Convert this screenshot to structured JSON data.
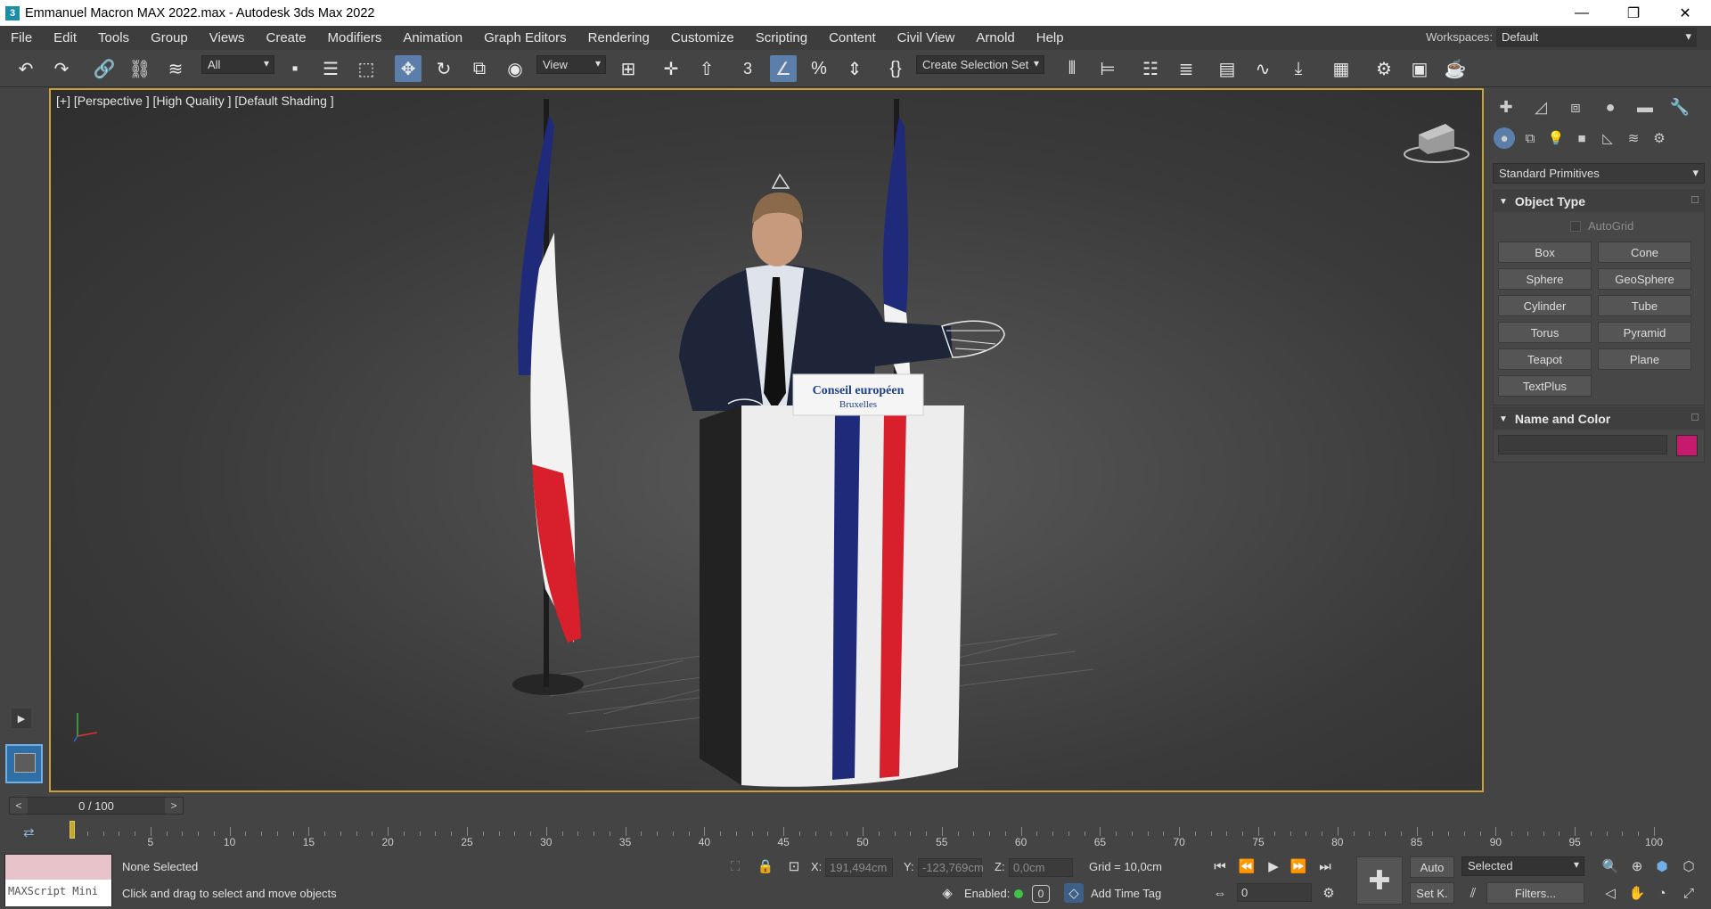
{
  "window": {
    "title": "Emmanuel Macron MAX 2022.max - Autodesk 3ds Max 2022",
    "app_icon": "3"
  },
  "menu": [
    "File",
    "Edit",
    "Tools",
    "Group",
    "Views",
    "Create",
    "Modifiers",
    "Animation",
    "Graph Editors",
    "Rendering",
    "Customize",
    "Scripting",
    "Content",
    "Civil View",
    "Arnold",
    "Help"
  ],
  "workspace": {
    "label": "Workspaces:",
    "value": "Default"
  },
  "toolbar": {
    "filter": "All",
    "ref_coord": "View",
    "selection_set": "Create Selection Set",
    "snap_label": "3"
  },
  "viewport": {
    "label": "[+] [Perspective ] [High Quality ] [Default Shading ]",
    "podium_sign_line1": "Conseil européen",
    "podium_sign_line2": "Bruxelles",
    "colors": {
      "flag_blue": "#1f2a7a",
      "flag_red": "#d8202c",
      "flag_white": "#f2f2f2",
      "frame": "#c9a13a"
    }
  },
  "command_panel": {
    "category": "Standard Primitives",
    "object_type": {
      "title": "Object Type",
      "autogrid": "AutoGrid",
      "buttons": [
        "Box",
        "Cone",
        "Sphere",
        "GeoSphere",
        "Cylinder",
        "Tube",
        "Torus",
        "Pyramid",
        "Teapot",
        "Plane",
        "TextPlus"
      ]
    },
    "name_color": {
      "title": "Name and Color",
      "swatch": "#c61a6f"
    }
  },
  "timeline": {
    "slider": "0 / 100",
    "ticks": [
      "5",
      "10",
      "15",
      "20",
      "25",
      "30",
      "35",
      "40",
      "45",
      "50",
      "55",
      "60",
      "65",
      "70",
      "75",
      "80",
      "85",
      "90",
      "95",
      "100"
    ]
  },
  "status": {
    "maxscript": "MAXScript Mini",
    "selection": "None Selected",
    "prompt": "Click and drag to select and move objects",
    "x_label": "X:",
    "x": "191,494cm",
    "y_label": "Y:",
    "y": "-123,769cm",
    "z_label": "Z:",
    "z": "0,0cm",
    "grid": "Grid = 10,0cm",
    "enabled": "Enabled:",
    "enabled_value": "0",
    "add_time_tag": "Add Time Tag",
    "auto": "Auto",
    "setk": "Set K.",
    "key_filter": "Selected",
    "filters": "Filters...",
    "frame": "0"
  }
}
